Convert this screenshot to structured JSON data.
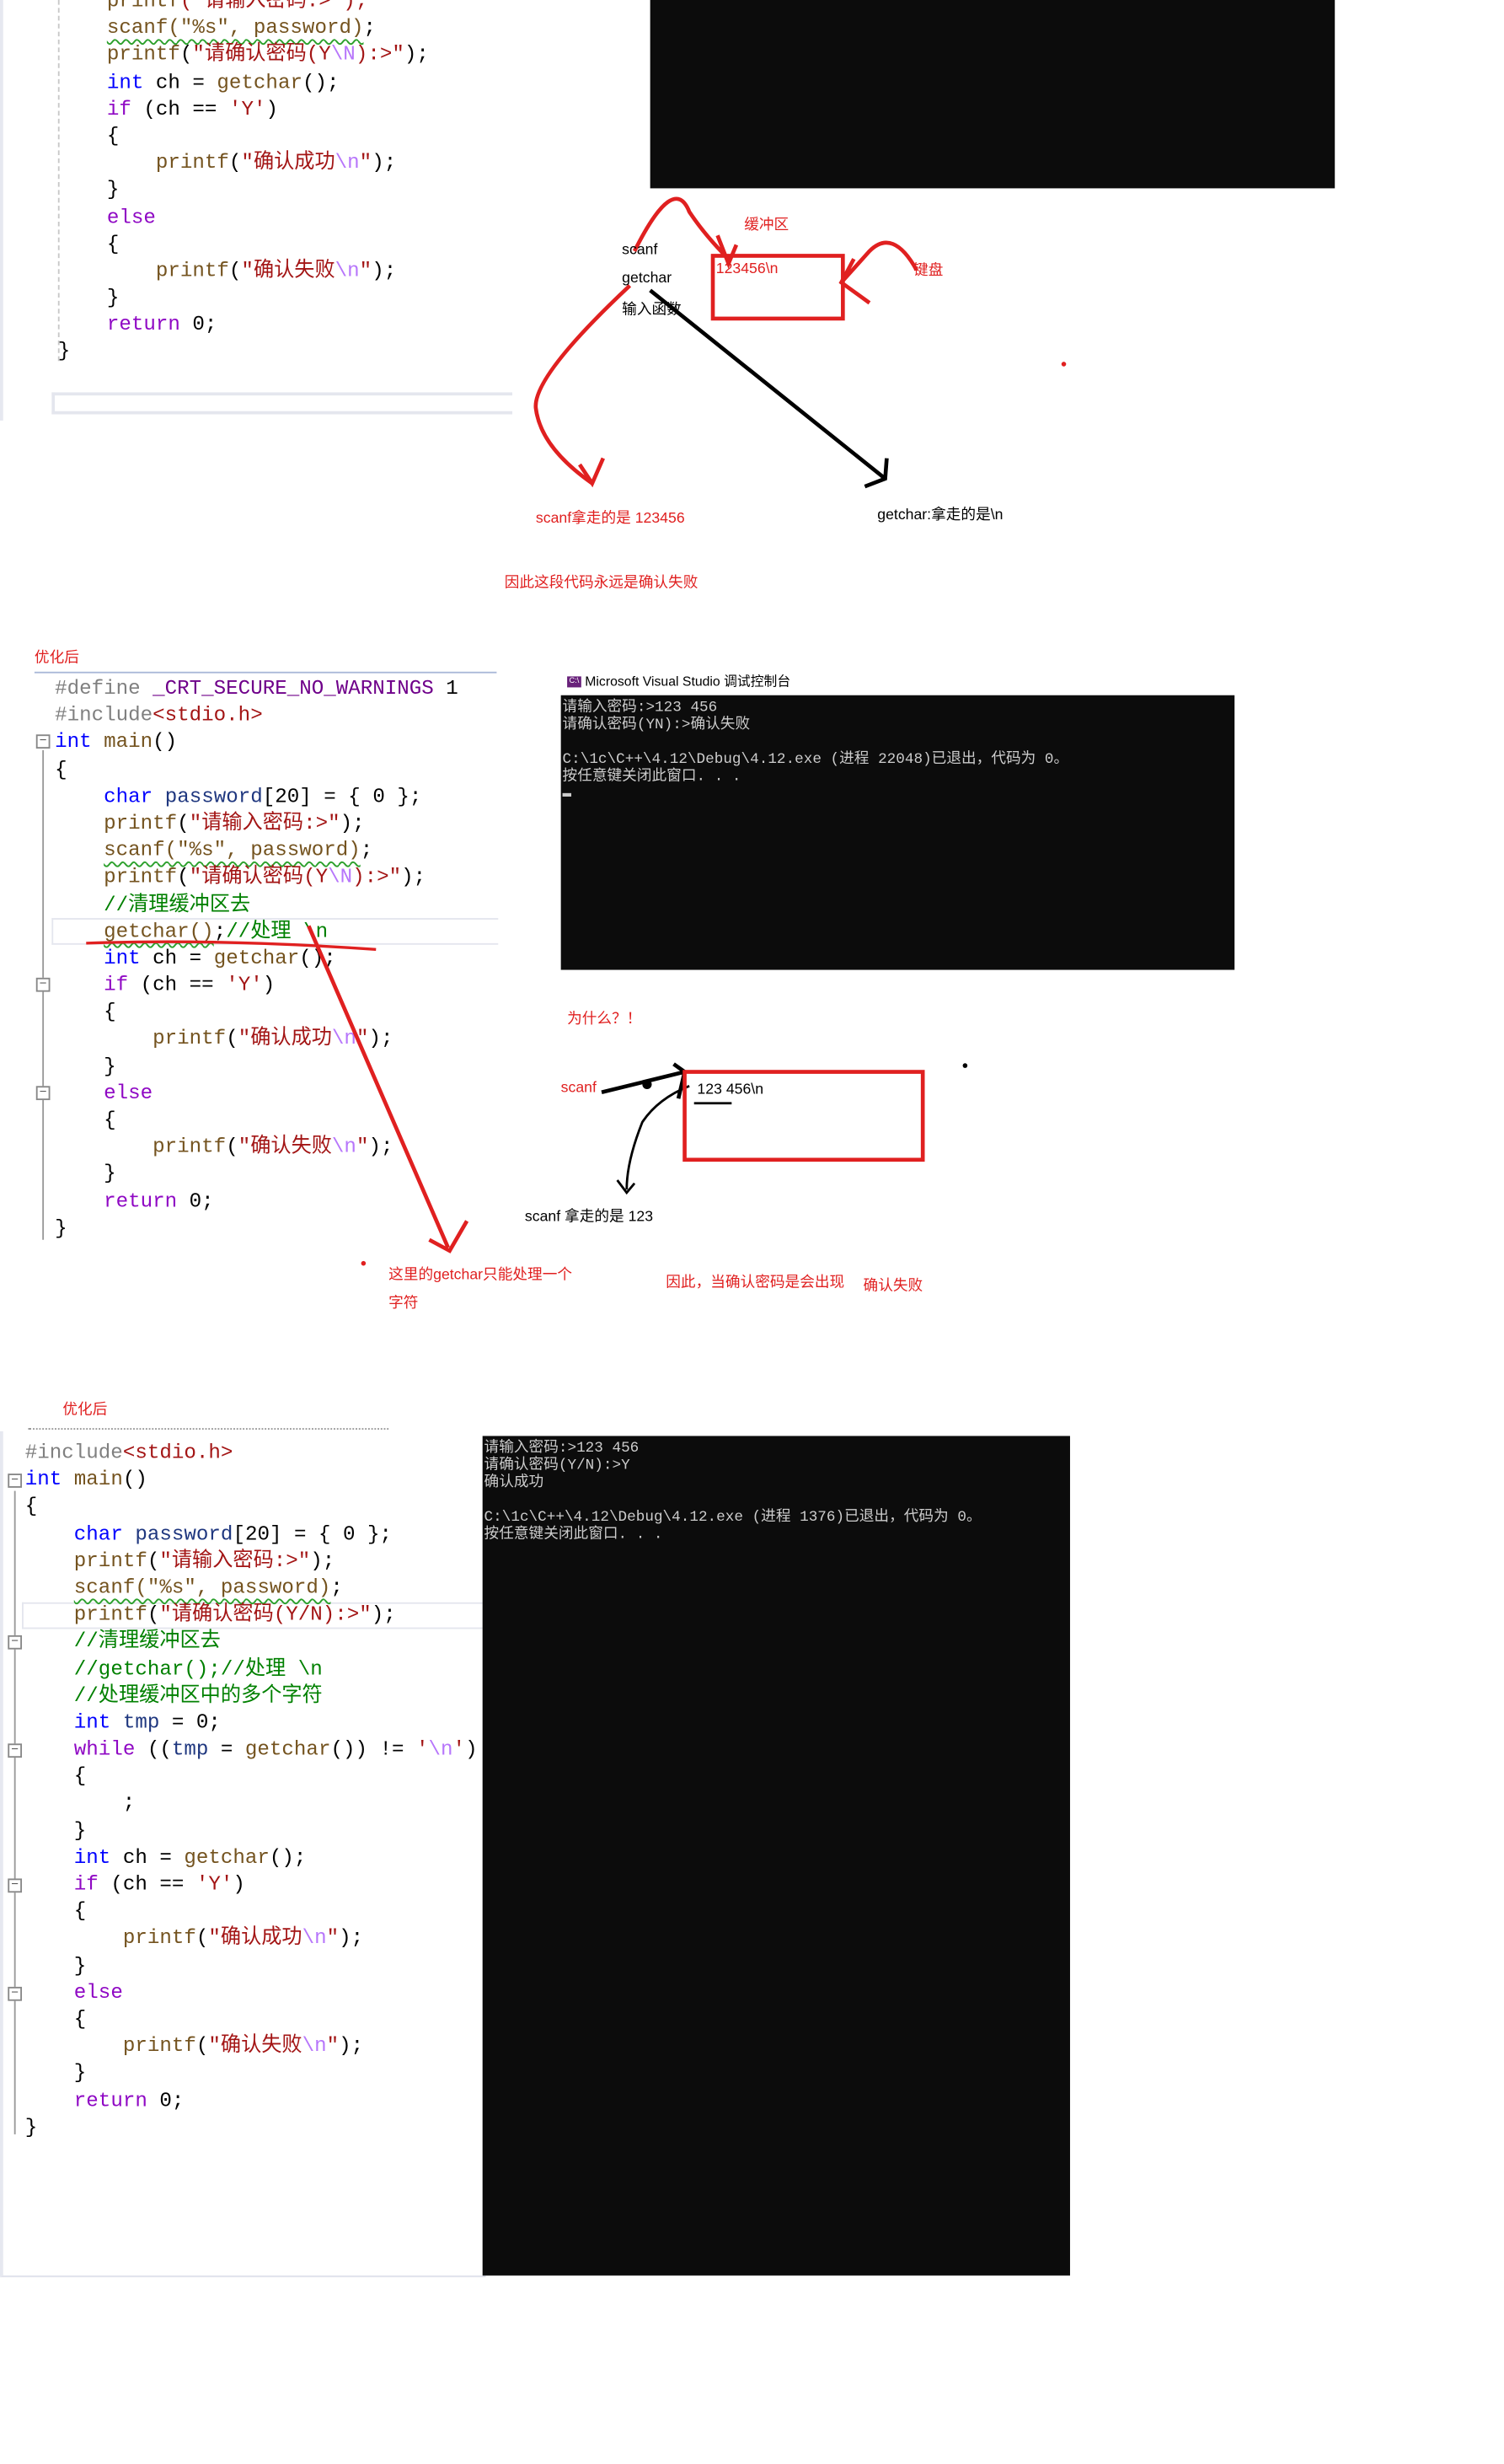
{
  "colors": {
    "annotation": "#e02020",
    "terminal_bg": "#0c0c0c",
    "terminal_fg": "#cccccc",
    "keyword": "#0000ff",
    "string": "#a31515",
    "comment": "#008000"
  },
  "section1": {
    "code": [
      [
        [
          "    ",
          "n"
        ],
        [
          "printf",
          "f"
        ],
        [
          "(\"请输入密码:>\");",
          "s"
        ]
      ],
      [
        [
          "    ",
          "n"
        ],
        [
          "scanf(\"%s\", password)",
          "sq"
        ],
        [
          ";",
          "n"
        ]
      ],
      [
        [
          "    ",
          "n"
        ],
        [
          "printf",
          "f"
        ],
        [
          "(",
          "n"
        ],
        [
          "\"请确认密码(Y",
          "s"
        ],
        [
          "\\N",
          "e"
        ],
        [
          "):>\"",
          "s"
        ],
        [
          ");",
          "n"
        ]
      ],
      [
        [
          "    ",
          "n"
        ],
        [
          "int",
          "k"
        ],
        [
          " ch = ",
          "n"
        ],
        [
          "getchar",
          "f"
        ],
        [
          "();",
          "n"
        ]
      ],
      [
        [
          "    ",
          "n"
        ],
        [
          "if",
          "kc"
        ],
        [
          " (ch == ",
          "n"
        ],
        [
          "'Y'",
          "s"
        ],
        [
          ")",
          "n"
        ]
      ],
      [
        [
          "    {",
          "n"
        ]
      ],
      [
        [
          "        ",
          "n"
        ],
        [
          "printf",
          "f"
        ],
        [
          "(",
          "n"
        ],
        [
          "\"确认成功",
          "s"
        ],
        [
          "\\n",
          "e"
        ],
        [
          "\"",
          "s"
        ],
        [
          ");",
          "n"
        ]
      ],
      [
        [
          "    }",
          "n"
        ]
      ],
      [
        [
          "    ",
          "n"
        ],
        [
          "else",
          "kc"
        ]
      ],
      [
        [
          "    {",
          "n"
        ]
      ],
      [
        [
          "        ",
          "n"
        ],
        [
          "printf",
          "f"
        ],
        [
          "(",
          "n"
        ],
        [
          "\"确认失败",
          "s"
        ],
        [
          "\\n",
          "e"
        ],
        [
          "\"",
          "s"
        ],
        [
          ");",
          "n"
        ]
      ],
      [
        [
          "    }",
          "n"
        ]
      ],
      [
        [
          "    ",
          "n"
        ],
        [
          "return",
          "kc"
        ],
        [
          " 0;",
          "n"
        ]
      ],
      [
        [
          "}",
          "n"
        ]
      ]
    ],
    "diagram": {
      "functions": [
        "scanf",
        "getchar",
        "输入函数"
      ],
      "buffer_label": "缓冲区",
      "buffer_content": "123456\\n",
      "keyboard_label": "键盘",
      "scanf_takes": "scanf拿走的是 123456",
      "getchar_takes": "getchar:拿走的是\\n",
      "conclusion": "因此这段代码永远是确认失败"
    }
  },
  "section2": {
    "heading": "优化后",
    "code": [
      [
        [
          "#define ",
          "p"
        ],
        [
          "_CRT_SECURE_NO_WARNINGS",
          "m"
        ],
        [
          " 1",
          "n"
        ]
      ],
      [
        [
          "#include",
          "p"
        ],
        [
          "<stdio.h>",
          "s"
        ]
      ],
      [
        [
          "int",
          "k"
        ],
        [
          " ",
          "n"
        ],
        [
          "main",
          "f"
        ],
        [
          "()",
          "n"
        ]
      ],
      [
        [
          "{",
          "n"
        ]
      ],
      [
        [
          "    ",
          "n"
        ],
        [
          "char",
          "k"
        ],
        [
          " ",
          "n"
        ],
        [
          "password",
          "v"
        ],
        [
          "[20] = { 0 };",
          "n"
        ]
      ],
      [
        [
          "    ",
          "n"
        ],
        [
          "printf",
          "f"
        ],
        [
          "(",
          "n"
        ],
        [
          "\"请输入密码:>\"",
          "s"
        ],
        [
          ");",
          "n"
        ]
      ],
      [
        [
          "    ",
          "n"
        ],
        [
          "scanf(\"%s\", password)",
          "sq"
        ],
        [
          ";",
          "n"
        ]
      ],
      [
        [
          "    ",
          "n"
        ],
        [
          "printf",
          "f"
        ],
        [
          "(",
          "n"
        ],
        [
          "\"请确认密码(Y",
          "s"
        ],
        [
          "\\N",
          "e"
        ],
        [
          "):>\"",
          "s"
        ],
        [
          ");",
          "n"
        ]
      ],
      [
        [
          "    ",
          "n"
        ],
        [
          "//清理缓冲区去",
          "c"
        ]
      ],
      [
        [
          "    ",
          "n"
        ],
        [
          "getchar()",
          "sq"
        ],
        [
          ";",
          "n"
        ],
        [
          "//处理 \\n",
          "c"
        ]
      ],
      [
        [
          "    ",
          "n"
        ],
        [
          "int",
          "k"
        ],
        [
          " ch = ",
          "n"
        ],
        [
          "getchar",
          "f"
        ],
        [
          "();",
          "n"
        ]
      ],
      [
        [
          "    ",
          "n"
        ],
        [
          "if",
          "kc"
        ],
        [
          " (ch == ",
          "n"
        ],
        [
          "'Y'",
          "s"
        ],
        [
          ")",
          "n"
        ]
      ],
      [
        [
          "    {",
          "n"
        ]
      ],
      [
        [
          "        ",
          "n"
        ],
        [
          "printf",
          "f"
        ],
        [
          "(",
          "n"
        ],
        [
          "\"确认成功",
          "s"
        ],
        [
          "\\n",
          "e"
        ],
        [
          "\"",
          "s"
        ],
        [
          ");",
          "n"
        ]
      ],
      [
        [
          "    }",
          "n"
        ]
      ],
      [
        [
          "    ",
          "n"
        ],
        [
          "else",
          "kc"
        ]
      ],
      [
        [
          "    {",
          "n"
        ]
      ],
      [
        [
          "        ",
          "n"
        ],
        [
          "printf",
          "f"
        ],
        [
          "(",
          "n"
        ],
        [
          "\"确认失败",
          "s"
        ],
        [
          "\\n",
          "e"
        ],
        [
          "\"",
          "s"
        ],
        [
          ");",
          "n"
        ]
      ],
      [
        [
          "    }",
          "n"
        ]
      ],
      [
        [
          "    ",
          "n"
        ],
        [
          "return",
          "kc"
        ],
        [
          " 0;",
          "n"
        ]
      ],
      [
        [
          "}",
          "n"
        ]
      ]
    ],
    "console_title": "Microsoft Visual Studio 调试控制台",
    "console_lines": [
      "请输入密码:>123 456",
      "请确认密码(YN):>确认失败",
      "",
      "C:\\1c\\C++\\4.12\\Debug\\4.12.exe (进程 22048)已退出，代码为 0。",
      "按任意键关闭此窗口. . .",
      "▬"
    ],
    "diagram": {
      "question": "为什么？！",
      "scanf_label": "scanf",
      "buffer_content": "123 456\\n",
      "scanf_takes": "scanf 拿走的是  123",
      "getchar_note_1": "这里的getchar只能处理一个",
      "getchar_note_2": "字符",
      "conclusion": "因此，当确认密码是会出现",
      "result": "确认失败"
    }
  },
  "section3": {
    "heading": "优化后",
    "code": [
      [
        [
          "#include",
          "p"
        ],
        [
          "<stdio.h>",
          "s"
        ]
      ],
      [
        [
          "int",
          "k"
        ],
        [
          " ",
          "n"
        ],
        [
          "main",
          "f"
        ],
        [
          "()",
          "n"
        ]
      ],
      [
        [
          "{",
          "n"
        ]
      ],
      [
        [
          "    ",
          "n"
        ],
        [
          "char",
          "k"
        ],
        [
          " ",
          "n"
        ],
        [
          "password",
          "v"
        ],
        [
          "[20] = { 0 };",
          "n"
        ]
      ],
      [
        [
          "    ",
          "n"
        ],
        [
          "printf",
          "f"
        ],
        [
          "(",
          "n"
        ],
        [
          "\"请输入密码:>\"",
          "s"
        ],
        [
          ");",
          "n"
        ]
      ],
      [
        [
          "    ",
          "n"
        ],
        [
          "scanf(\"%s\", password)",
          "sq"
        ],
        [
          ";",
          "n"
        ]
      ],
      [
        [
          "    ",
          "n"
        ],
        [
          "printf",
          "f"
        ],
        [
          "(",
          "n"
        ],
        [
          "\"请确认密码(Y/N):>\"",
          "s"
        ],
        [
          ");",
          "n"
        ]
      ],
      [
        [
          "    ",
          "n"
        ],
        [
          "//清理缓冲区去",
          "c"
        ]
      ],
      [
        [
          "    ",
          "n"
        ],
        [
          "//getchar();//处理 \\n",
          "c"
        ]
      ],
      [
        [
          "    ",
          "n"
        ],
        [
          "//处理缓冲区中的多个字符",
          "c"
        ]
      ],
      [
        [
          "    ",
          "n"
        ],
        [
          "int",
          "k"
        ],
        [
          " ",
          "n"
        ],
        [
          "tmp",
          "v"
        ],
        [
          " = 0;",
          "n"
        ]
      ],
      [
        [
          "    ",
          "n"
        ],
        [
          "while",
          "kc"
        ],
        [
          " ((",
          "n"
        ],
        [
          "tmp",
          "v"
        ],
        [
          " = ",
          "n"
        ],
        [
          "getchar",
          "f"
        ],
        [
          "()) != ",
          "n"
        ],
        [
          "'",
          "s"
        ],
        [
          "\\n",
          "e"
        ],
        [
          "'",
          "s"
        ],
        [
          ")",
          "n"
        ]
      ],
      [
        [
          "    {",
          "n"
        ]
      ],
      [
        [
          "        ;",
          "n"
        ]
      ],
      [
        [
          "    }",
          "n"
        ]
      ],
      [
        [
          "    ",
          "n"
        ],
        [
          "int",
          "k"
        ],
        [
          " ch = ",
          "n"
        ],
        [
          "getchar",
          "f"
        ],
        [
          "();",
          "n"
        ]
      ],
      [
        [
          "    ",
          "n"
        ],
        [
          "if",
          "kc"
        ],
        [
          " (ch == ",
          "n"
        ],
        [
          "'Y'",
          "s"
        ],
        [
          ")",
          "n"
        ]
      ],
      [
        [
          "    {",
          "n"
        ]
      ],
      [
        [
          "        ",
          "n"
        ],
        [
          "printf",
          "f"
        ],
        [
          "(",
          "n"
        ],
        [
          "\"确认成功",
          "s"
        ],
        [
          "\\n",
          "e"
        ],
        [
          "\"",
          "s"
        ],
        [
          ");",
          "n"
        ]
      ],
      [
        [
          "    }",
          "n"
        ]
      ],
      [
        [
          "    ",
          "n"
        ],
        [
          "else",
          "kc"
        ]
      ],
      [
        [
          "    {",
          "n"
        ]
      ],
      [
        [
          "        ",
          "n"
        ],
        [
          "printf",
          "f"
        ],
        [
          "(",
          "n"
        ],
        [
          "\"确认失败",
          "s"
        ],
        [
          "\\n",
          "e"
        ],
        [
          "\"",
          "s"
        ],
        [
          ");",
          "n"
        ]
      ],
      [
        [
          "    }",
          "n"
        ]
      ],
      [
        [
          "    ",
          "n"
        ],
        [
          "return",
          "kc"
        ],
        [
          " 0;",
          "n"
        ]
      ],
      [
        [
          "}",
          "n"
        ]
      ]
    ],
    "console_lines": [
      "请输入密码:>123 456",
      "请确认密码(Y/N):>Y",
      "确认成功",
      "",
      "C:\\1c\\C++\\4.12\\Debug\\4.12.exe (进程 1376)已退出，代码为 0。",
      "按任意键关闭此窗口. . ."
    ]
  }
}
